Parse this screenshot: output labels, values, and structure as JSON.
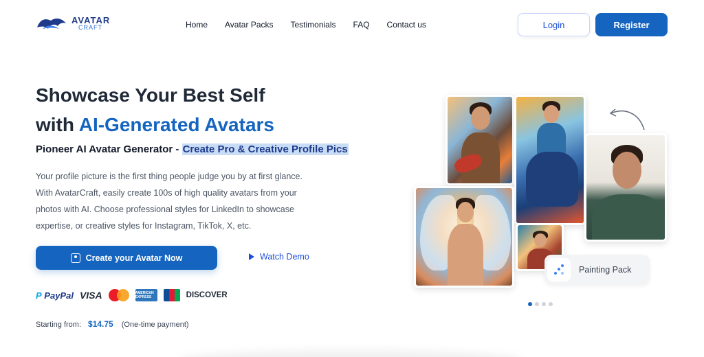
{
  "brand": {
    "line1": "AVATAR",
    "line2": "CRAFT"
  },
  "nav": {
    "items": [
      {
        "label": "Home"
      },
      {
        "label": "Avatar Packs"
      },
      {
        "label": "Testimonials"
      },
      {
        "label": "FAQ"
      },
      {
        "label": "Contact us"
      }
    ],
    "login_label": "Login",
    "register_label": "Register"
  },
  "hero": {
    "title_line1": "Showcase Your Best Self",
    "title_line2_prefix": "with ",
    "title_line2_accent": "AI-Generated Avatars",
    "subtitle_prefix": "Pioneer AI Avatar Generator - ",
    "subtitle_highlight": "Create Pro & Creative Profile Pics",
    "description": "Your profile picture is the first thing people judge you by at first glance. With AvatarCraft, easily create 100s of high quality avatars from your photos with AI. Choose professional styles for LinkedIn to showcase expertise, or creative styles for Instagram, TikTok, X, etc.",
    "cta_label": "Create your Avatar Now",
    "watch_label": "Watch Demo"
  },
  "payments": {
    "paypal": "PayPal",
    "visa": "VISA",
    "amex": "AMERICAN EXPRESS",
    "discover": "DISCOVER"
  },
  "pricing": {
    "prefix": "Starting from:",
    "price": "$14.75",
    "note": "(One-time payment)"
  },
  "collage": {
    "pack_label": "Painting Pack",
    "carousel_index": 1,
    "carousel_total": 4
  },
  "colors": {
    "accent": "#1565c0",
    "highlight_bg": "#c9dcf5",
    "text_dark": "#1f2937"
  }
}
